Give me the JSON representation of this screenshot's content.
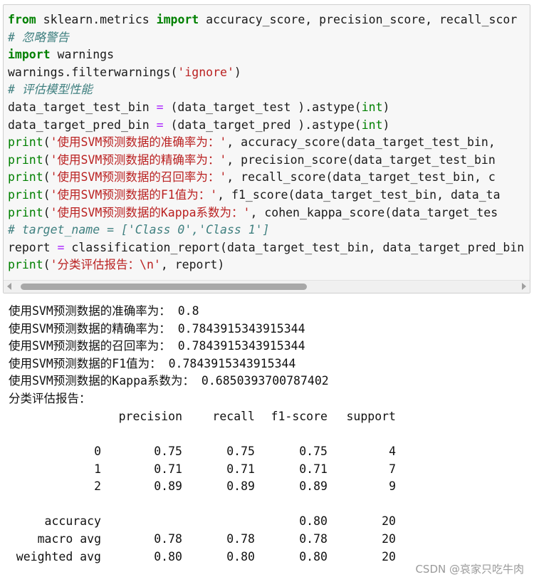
{
  "code": {
    "lines": [
      [
        {
          "t": "from",
          "c": "kw"
        },
        {
          "t": " sklearn.metrics ",
          "c": "pl"
        },
        {
          "t": "import",
          "c": "kw"
        },
        {
          "t": " accuracy_score, precision_score, recall_scor",
          "c": "pl"
        }
      ],
      [
        {
          "t": "# 忽略警告",
          "c": "cm"
        }
      ],
      [
        {
          "t": "import",
          "c": "kw"
        },
        {
          "t": " warnings",
          "c": "pl"
        }
      ],
      [
        {
          "t": "warnings.filterwarnings(",
          "c": "pl"
        },
        {
          "t": "'ignore'",
          "c": "st"
        },
        {
          "t": ")",
          "c": "pl"
        }
      ],
      [
        {
          "t": "# 评估模型性能",
          "c": "cm"
        }
      ],
      [
        {
          "t": "data_target_test_bin ",
          "c": "pl"
        },
        {
          "t": "=",
          "c": "op"
        },
        {
          "t": " (data_target_test ).astype(",
          "c": "pl"
        },
        {
          "t": "int",
          "c": "bi"
        },
        {
          "t": ")",
          "c": "pl"
        }
      ],
      [
        {
          "t": "data_target_pred_bin ",
          "c": "pl"
        },
        {
          "t": "=",
          "c": "op"
        },
        {
          "t": " (data_target_pred ).astype(",
          "c": "pl"
        },
        {
          "t": "int",
          "c": "bi"
        },
        {
          "t": ")",
          "c": "pl"
        }
      ],
      [
        {
          "t": "print",
          "c": "bi"
        },
        {
          "t": "(",
          "c": "pl"
        },
        {
          "t": "'使用SVM预测数据的准确率为：'",
          "c": "st"
        },
        {
          "t": ", accuracy_score(data_target_test_bin,",
          "c": "pl"
        }
      ],
      [
        {
          "t": "print",
          "c": "bi"
        },
        {
          "t": "(",
          "c": "pl"
        },
        {
          "t": "'使用SVM预测数据的精确率为：'",
          "c": "st"
        },
        {
          "t": ", precision_score(data_target_test_bin",
          "c": "pl"
        }
      ],
      [
        {
          "t": "print",
          "c": "bi"
        },
        {
          "t": "(",
          "c": "pl"
        },
        {
          "t": "'使用SVM预测数据的召回率为：'",
          "c": "st"
        },
        {
          "t": ", recall_score(data_target_test_bin, c",
          "c": "pl"
        }
      ],
      [
        {
          "t": "print",
          "c": "bi"
        },
        {
          "t": "(",
          "c": "pl"
        },
        {
          "t": "'使用SVM预测数据的F1值为：'",
          "c": "st"
        },
        {
          "t": ", f1_score(data_target_test_bin, data_ta",
          "c": "pl"
        }
      ],
      [
        {
          "t": "print",
          "c": "bi"
        },
        {
          "t": "(",
          "c": "pl"
        },
        {
          "t": "'使用SVM预测数据的Kappa系数为：'",
          "c": "st"
        },
        {
          "t": ", cohen_kappa_score(data_target_tes",
          "c": "pl"
        }
      ],
      [
        {
          "t": "# target_name = ['Class 0','Class 1']",
          "c": "cm"
        }
      ],
      [
        {
          "t": "report ",
          "c": "pl"
        },
        {
          "t": "=",
          "c": "op"
        },
        {
          "t": " classification_report(data_target_test_bin, data_target_pred_bin",
          "c": "pl"
        }
      ],
      [
        {
          "t": "print",
          "c": "bi"
        },
        {
          "t": "(",
          "c": "pl"
        },
        {
          "t": "'分类评估报告：\\n'",
          "c": "st"
        },
        {
          "t": ", report)",
          "c": "pl"
        }
      ]
    ]
  },
  "output": {
    "lines": [
      "使用SVM预测数据的准确率为： 0.8",
      "使用SVM预测数据的精确率为： 0.7843915343915344",
      "使用SVM预测数据的召回率为： 0.7843915343915344",
      "使用SVM预测数据的F1值为： 0.7843915343915344",
      "使用SVM预测数据的Kappa系数为： 0.6850393700787402",
      "分类评估报告："
    ],
    "report": {
      "headers": [
        "",
        "precision",
        "recall",
        "f1-score",
        "support"
      ],
      "rows": [
        [
          "0",
          "0.75",
          "0.75",
          "0.75",
          "4"
        ],
        [
          "1",
          "0.71",
          "0.71",
          "0.71",
          "7"
        ],
        [
          "2",
          "0.89",
          "0.89",
          "0.89",
          "9"
        ],
        [
          "",
          "",
          "",
          "",
          ""
        ],
        [
          "accuracy",
          "",
          "",
          "0.80",
          "20"
        ],
        [
          "macro avg",
          "0.78",
          "0.78",
          "0.78",
          "20"
        ],
        [
          "weighted avg",
          "0.80",
          "0.80",
          "0.80",
          "20"
        ]
      ]
    }
  },
  "watermark": "CSDN @哀家只吃牛肉"
}
